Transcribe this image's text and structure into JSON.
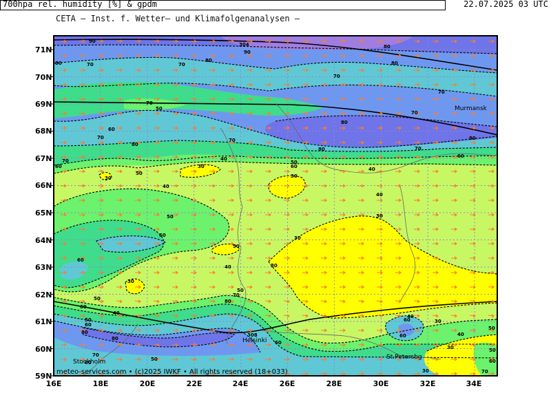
{
  "header": {
    "line1": "CETA — Inst. f. Wetter— und Klimafolgenanalysen —",
    "title": "700hpa rel. humidity [%] & gpdm",
    "datetime": "22.07.2025 03 UTC"
  },
  "footer": "meteo-services.com • (c)2025 IWKF • All rights reserved (18+033)",
  "lat_labels": [
    "71N",
    "70N",
    "69N",
    "68N",
    "67N",
    "66N",
    "65N",
    "64N",
    "63N",
    "62N",
    "61N",
    "60N",
    "59N"
  ],
  "lon_labels": [
    "16E",
    "18E",
    "20E",
    "22E",
    "24E",
    "26E",
    "28E",
    "30E",
    "32E",
    "34E"
  ],
  "cities": [
    "Murmansk",
    "Helsinki",
    "Stockholm",
    "St.Petersbg"
  ],
  "contour_labels": [
    "30",
    "40",
    "50",
    "60",
    "70",
    "80",
    "90",
    "30",
    "40",
    "50",
    "60",
    "70",
    "80",
    "90",
    "30",
    "40",
    "50",
    "60",
    "70",
    "80",
    "304",
    "305",
    "308"
  ],
  "colors": {
    "humidity_30": "#ffff00",
    "humidity_40": "#c8f764",
    "humidity_50": "#6cf26c",
    "humidity_60": "#3fdc8c",
    "humidity_70": "#5fc8d4",
    "humidity_80": "#6e98f0",
    "humidity_90": "#6f74e8",
    "humidity_95": "#a07de0",
    "wind_arrow": "#ff7a2a",
    "grid": "#8a8ad0"
  }
}
